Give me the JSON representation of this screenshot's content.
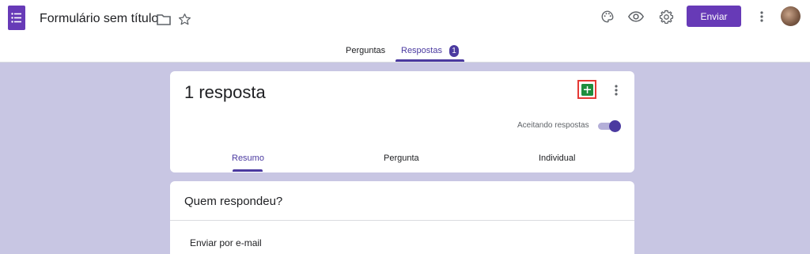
{
  "header": {
    "form_title": "Formulário sem título",
    "send_label": "Enviar",
    "icons": [
      "forms-logo-icon",
      "folder-icon",
      "star-icon",
      "palette-icon",
      "eye-icon",
      "gear-icon",
      "more-vert-icon",
      "avatar"
    ]
  },
  "tabs": {
    "questions": "Perguntas",
    "responses": "Respostas",
    "responses_badge": "1",
    "active": "Respostas"
  },
  "responses_card": {
    "count_label": "1 resposta",
    "accepting_label": "Aceitando respostas",
    "accepting_on": true,
    "subtabs": {
      "summary": "Resumo",
      "question": "Pergunta",
      "individual": "Individual",
      "active": "Resumo"
    }
  },
  "who_card": {
    "title": "Quem respondeu?",
    "email_label": "Enviar por e-mail"
  },
  "colors": {
    "accent": "#673ab7",
    "tab_accent": "#4b3aa0",
    "page_bg": "#c8c6e3",
    "sheets_green": "#1e8e3e",
    "highlight_red": "#e53935"
  }
}
